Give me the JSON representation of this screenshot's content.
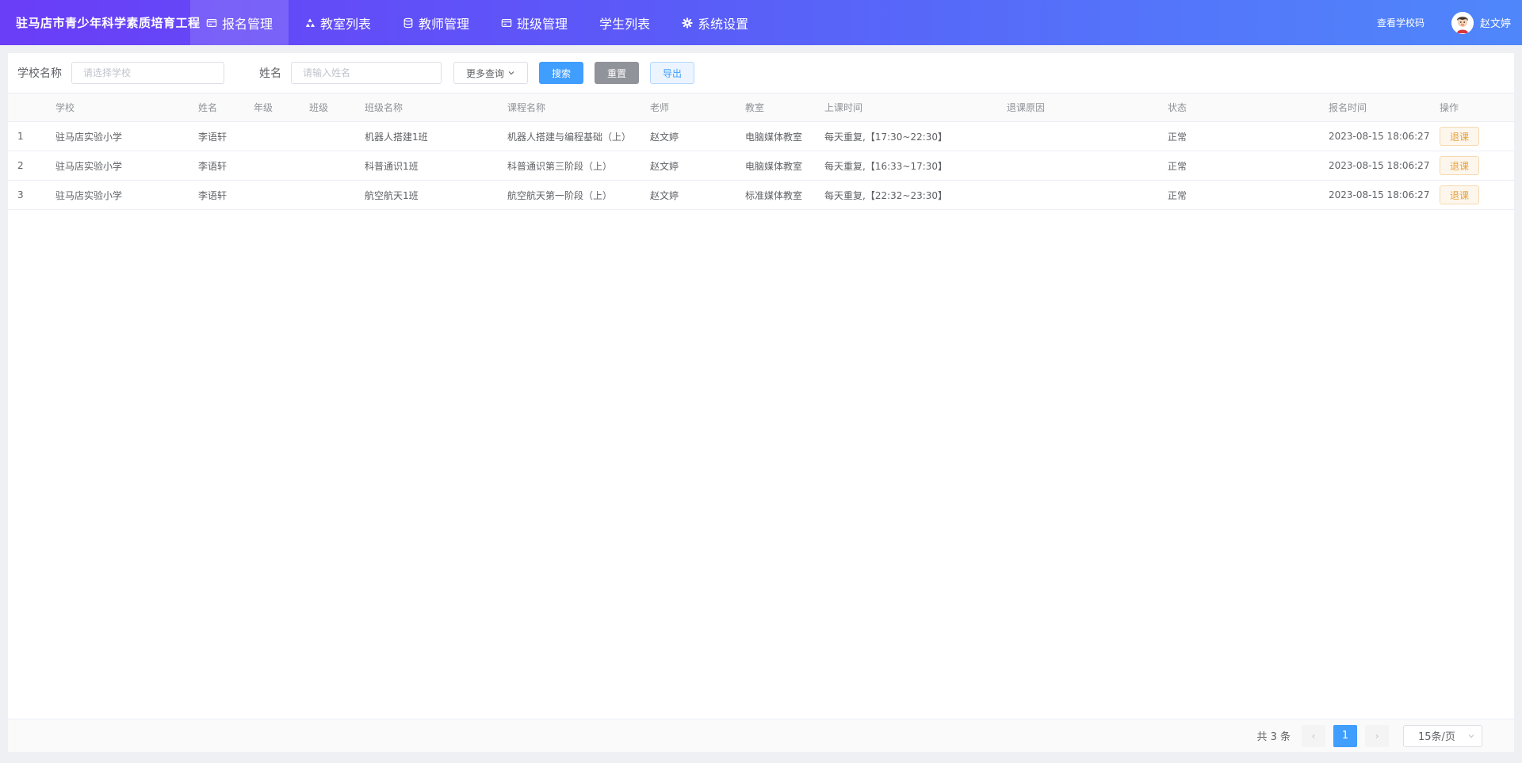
{
  "header": {
    "brand": "驻马店市青少年科学素质培育工程",
    "nav": [
      {
        "label": "报名管理",
        "icon": "card-icon",
        "active": true
      },
      {
        "label": "教室列表",
        "icon": "recycle-icon",
        "active": false
      },
      {
        "label": "教师管理",
        "icon": "database-icon",
        "active": false
      },
      {
        "label": "班级管理",
        "icon": "card-icon",
        "active": false
      },
      {
        "label": "学生列表",
        "icon": "",
        "active": false
      },
      {
        "label": "系统设置",
        "icon": "gear-icon",
        "active": false
      }
    ],
    "school_code_link": "查看学校码",
    "username": "赵文婷"
  },
  "filters": {
    "school_label": "学校名称",
    "school_placeholder": "请选择学校",
    "name_label": "姓名",
    "name_placeholder": "请输入姓名",
    "more_button": "更多查询",
    "search_button": "搜索",
    "reset_button": "重置",
    "export_button": "导出"
  },
  "table": {
    "columns": [
      "",
      "学校",
      "姓名",
      "年级",
      "班级",
      "班级名称",
      "课程名称",
      "老师",
      "教室",
      "上课时间",
      "退课原因",
      "状态",
      "报名时间",
      "操作"
    ],
    "rows": [
      {
        "index": "1",
        "school": "驻马店实验小学",
        "name": "李语轩",
        "grade": "",
        "class": "",
        "class_name": "机器人搭建1班",
        "course": "机器人搭建与编程基础（上）",
        "teacher": "赵文婷",
        "room": "电脑媒体教室",
        "time": "每天重复,【17:30~22:30】",
        "reason": "",
        "status": "正常",
        "signup_time": "2023-08-15 18:06:27",
        "action": "退课"
      },
      {
        "index": "2",
        "school": "驻马店实验小学",
        "name": "李语轩",
        "grade": "",
        "class": "",
        "class_name": "科普通识1班",
        "course": "科普通识第三阶段（上）",
        "teacher": "赵文婷",
        "room": "电脑媒体教室",
        "time": "每天重复,【16:33~17:30】",
        "reason": "",
        "status": "正常",
        "signup_time": "2023-08-15 18:06:27",
        "action": "退课"
      },
      {
        "index": "3",
        "school": "驻马店实验小学",
        "name": "李语轩",
        "grade": "",
        "class": "",
        "class_name": "航空航天1班",
        "course": "航空航天第一阶段（上）",
        "teacher": "赵文婷",
        "room": "标准媒体教室",
        "time": "每天重复,【22:32~23:30】",
        "reason": "",
        "status": "正常",
        "signup_time": "2023-08-15 18:06:27",
        "action": "退课"
      }
    ]
  },
  "pagination": {
    "total_text": "共 3 条",
    "current_page": "1",
    "prev_symbol": "‹",
    "next_symbol": "›",
    "page_size": "15条/页"
  },
  "colors": {
    "header_gradient_start": "#6a3df7",
    "header_gradient_end": "#4f87fb",
    "primary": "#409eff",
    "warning": "#e6a23c"
  }
}
